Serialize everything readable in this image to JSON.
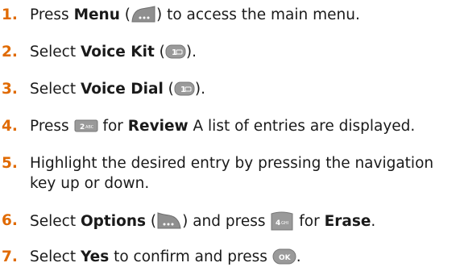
{
  "steps": [
    {
      "num": "1.",
      "a": "Press ",
      "b": "Menu",
      "c": " (",
      "d": ") to access the main menu.",
      "icon": "menu-softkey-icon"
    },
    {
      "num": "2.",
      "a": "Select ",
      "b": "Voice Kit",
      "c": " (",
      "d": ").",
      "icon": "key-1-icon",
      "key_label": "1"
    },
    {
      "num": "3.",
      "a": "Select ",
      "b": "Voice Dial",
      "c": " (",
      "d": ").",
      "icon": "key-1-icon",
      "key_label": "1"
    },
    {
      "num": "4.",
      "a": "Press ",
      "b": " for ",
      "c": "Review",
      "d": " A list of entries are displayed.",
      "icon": "key-2abc-icon",
      "key_label": "2ABC"
    },
    {
      "num": "5.",
      "a": "Highlight the desired entry by pressing the navigation",
      "b": "key up or down."
    },
    {
      "num": "6.",
      "a": "Select ",
      "b": "Options",
      "c": " (",
      "d": ") and press ",
      "e": " for ",
      "f": "Erase",
      "g": ".",
      "icon": "options-softkey-icon",
      "icon2": "key-4ghi-icon",
      "key_label": "4GHI"
    },
    {
      "num": "7.",
      "a": "Select ",
      "b": "Yes",
      "c": " to confirm and press ",
      "d": ".",
      "icon": "ok-key-icon",
      "key_label": "OK"
    }
  ],
  "colors": {
    "step_number": "#e06a00",
    "key_face": "#9a9a9a",
    "text": "#1a1a1a"
  }
}
